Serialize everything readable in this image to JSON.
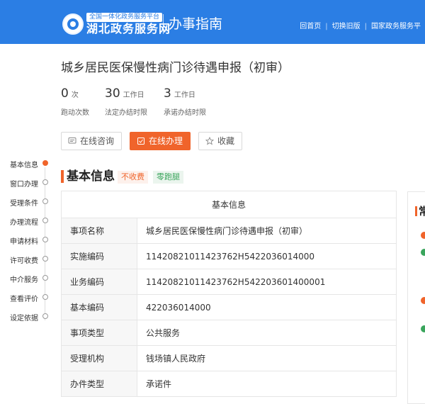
{
  "header": {
    "platform_tag": "全国一体化政务服务平台",
    "site_name": "湖北政务服务网",
    "section": "办事指南",
    "links": [
      "回首页",
      "切换旧版",
      "国家政务服务平"
    ]
  },
  "item": {
    "title": "城乡居民医保慢性病门诊待遇申报（初审）",
    "stats": [
      {
        "value": "0",
        "unit": "次",
        "label": "跑动次数"
      },
      {
        "value": "30",
        "unit": "工作日",
        "label": "法定办结时限"
      },
      {
        "value": "3",
        "unit": "工作日",
        "label": "承诺办结时限"
      }
    ]
  },
  "actions": {
    "consult": "在线咨询",
    "apply": "在线办理",
    "favorite": "收藏"
  },
  "leftnav": [
    "基本信息",
    "窗口办理",
    "受理条件",
    "办理流程",
    "申请材料",
    "许可收费",
    "中介服务",
    "查看评价",
    "设定依据"
  ],
  "basic_info": {
    "heading": "基本信息",
    "tags": [
      "不收费",
      "零跑腿"
    ],
    "table_title": "基本信息",
    "rows": [
      {
        "key": "事项名称",
        "value": "城乡居民医保慢性病门诊待遇申报（初审）"
      },
      {
        "key": "实施编码",
        "value": "11420821011423762H5422036014000"
      },
      {
        "key": "业务编码",
        "value": "11420821011423762H542203601400001"
      },
      {
        "key": "基本编码",
        "value": "422036014000"
      },
      {
        "key": "事项类型",
        "value": "公共服务"
      },
      {
        "key": "受理机构",
        "value": "钱场镇人民政府"
      },
      {
        "key": "办件类型",
        "value": "承诺件"
      }
    ]
  },
  "right_panel": {
    "heading_fragment": "常"
  },
  "colors": {
    "brand_blue": "#2b7ee4",
    "accent_orange": "#f0642b",
    "tag_green": "#3aa55c"
  }
}
